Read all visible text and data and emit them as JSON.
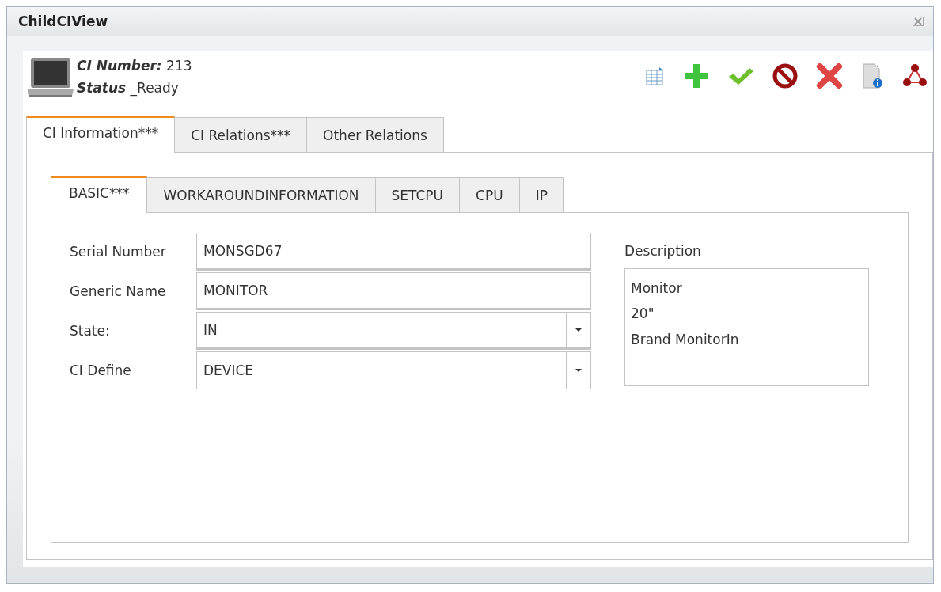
{
  "window": {
    "title": "ChildCIView"
  },
  "header": {
    "number_label": "CI Number:",
    "number": "213",
    "status_label": "Status",
    "status": "_Ready"
  },
  "tabs": [
    {
      "label": "CI Information***",
      "selected": true
    },
    {
      "label": "CI Relations***",
      "selected": false
    },
    {
      "label": "Other Relations",
      "selected": false
    }
  ],
  "subtabs": [
    {
      "label": "BASIC***",
      "selected": true
    },
    {
      "label": "WORKAROUNDINFORMATION",
      "selected": false
    },
    {
      "label": "SETCPU",
      "selected": false
    },
    {
      "label": "CPU",
      "selected": false
    },
    {
      "label": "IP",
      "selected": false
    }
  ],
  "fields": [
    {
      "label": "Serial Number",
      "value": "MONSGD67",
      "kind": "text"
    },
    {
      "label": "Generic Name",
      "value": "MONITOR",
      "kind": "text"
    },
    {
      "label": "State:",
      "value": "IN",
      "kind": "select"
    },
    {
      "label": "CI Define",
      "value": "DEVICE",
      "kind": "select"
    }
  ],
  "description": {
    "label": "Description",
    "value": "Monitor\n20\"\nBrand MonitorIn"
  }
}
